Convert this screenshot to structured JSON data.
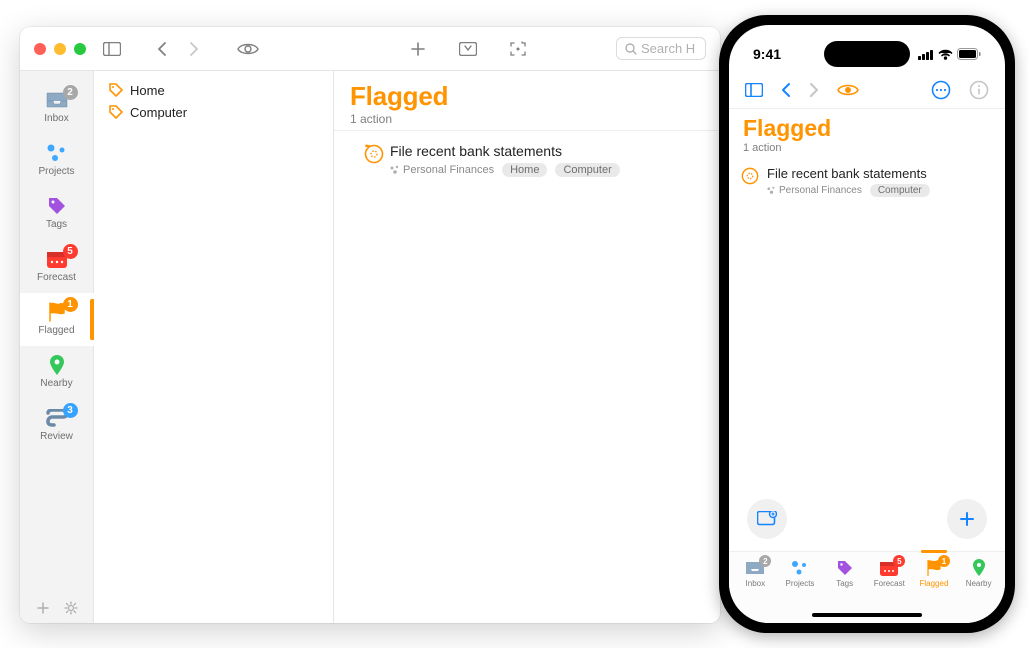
{
  "mac": {
    "search_placeholder": "Search H",
    "nav": {
      "inbox": {
        "label": "Inbox",
        "badge": "2"
      },
      "projects": {
        "label": "Projects"
      },
      "tags": {
        "label": "Tags"
      },
      "forecast": {
        "label": "Forecast",
        "badge": "5"
      },
      "flagged": {
        "label": "Flagged",
        "badge": "1"
      },
      "nearby": {
        "label": "Nearby"
      },
      "review": {
        "label": "Review",
        "badge": "3"
      }
    },
    "outline": {
      "items": [
        {
          "label": "Home"
        },
        {
          "label": "Computer"
        }
      ]
    },
    "main": {
      "title": "Flagged",
      "subtitle": "1 action",
      "action": {
        "title": "File recent bank statements",
        "project": "Personal Finances",
        "tags": [
          "Home",
          "Computer"
        ]
      }
    }
  },
  "phone": {
    "time": "9:41",
    "title": "Flagged",
    "subtitle": "1 action",
    "action": {
      "title": "File recent bank statements",
      "project": "Personal Finances",
      "tags": [
        "Computer"
      ]
    },
    "tabs": {
      "inbox": {
        "label": "Inbox",
        "badge": "2"
      },
      "projects": {
        "label": "Projects"
      },
      "tags": {
        "label": "Tags"
      },
      "forecast": {
        "label": "Forecast",
        "badge": "5"
      },
      "flagged": {
        "label": "Flagged",
        "badge": "1"
      },
      "nearby": {
        "label": "Nearby"
      }
    }
  },
  "colors": {
    "accent": "#ff9400",
    "blue": "#1784ff",
    "purple": "#a352e0",
    "red": "#ff3b30",
    "green": "#34c759"
  }
}
